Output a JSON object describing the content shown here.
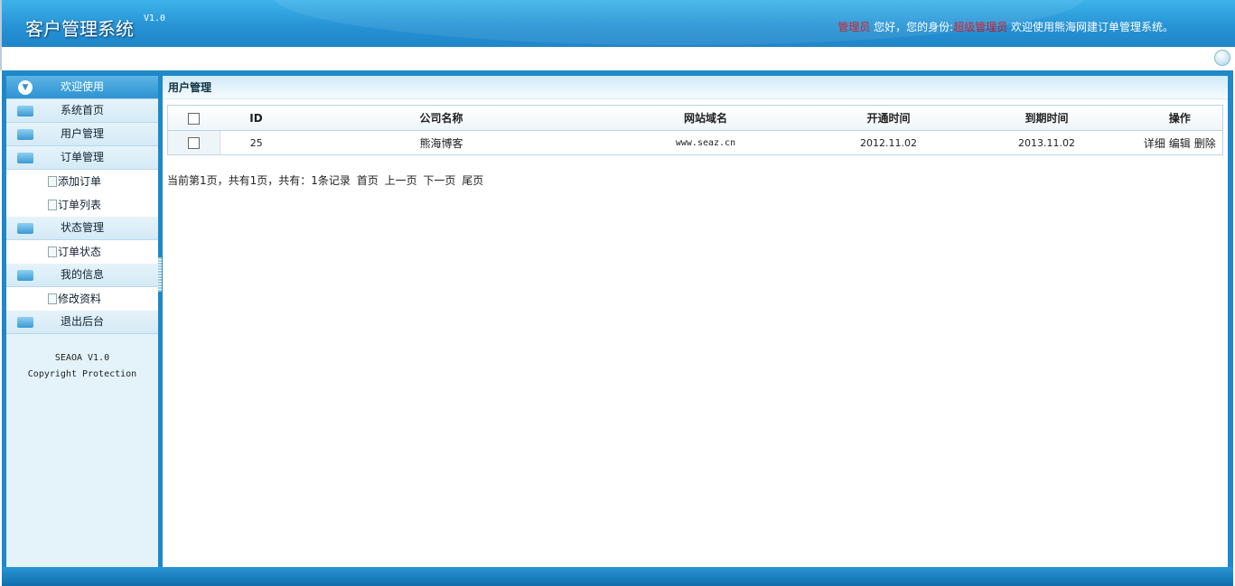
{
  "header": {
    "title": "客户管理系统",
    "version": "V1.0",
    "user": "管理员",
    "greeting": "您好，您的身份:",
    "role": "超级管理员",
    "welcome": "欢迎使用熊海网建订单管理系统。"
  },
  "sidebar": {
    "sections": [
      {
        "label": "欢迎使用"
      },
      {
        "label": "系统首页"
      },
      {
        "label": "用户管理"
      },
      {
        "label": "订单管理"
      },
      {
        "label": "状态管理"
      },
      {
        "label": "我的信息"
      },
      {
        "label": "退出后台"
      }
    ],
    "subs": [
      {
        "label": "添加订单"
      },
      {
        "label": "订单列表"
      },
      {
        "label": "订单状态"
      },
      {
        "label": "修改资料"
      }
    ],
    "copyright1": "SEAOA V1.0",
    "copyright2": "Copyright Protection"
  },
  "main": {
    "title": "用户管理",
    "columns": [
      "ID",
      "公司名称",
      "网站域名",
      "开通时间",
      "到期时间",
      "操作"
    ],
    "rows": [
      {
        "id": "25",
        "company": "熊海博客",
        "domain": "www.seaz.cn",
        "start": "2012.11.02",
        "end": "2013.11.02",
        "ops": [
          "详细",
          "编辑",
          "删除"
        ]
      }
    ],
    "pager": {
      "info": "当前第1页，共有1页，共有：1条记录",
      "first": "首页",
      "prev": "上一页",
      "next": "下一页",
      "last": "尾页"
    }
  }
}
